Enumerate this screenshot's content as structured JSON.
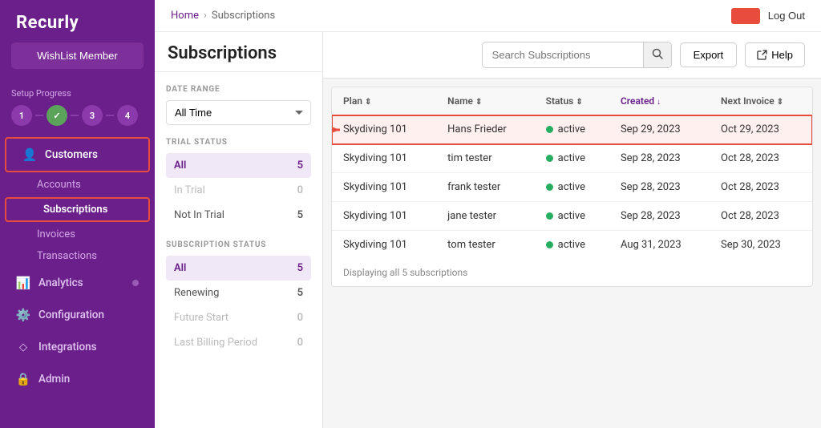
{
  "sidebar": {
    "logo": "Recurly",
    "member_button": "WishList Member",
    "setup": {
      "label": "Setup Progress",
      "steps": [
        "1",
        "✓",
        "3",
        "4"
      ]
    },
    "nav": [
      {
        "id": "customers",
        "label": "Customers",
        "icon": "👤",
        "active": true
      },
      {
        "id": "accounts",
        "label": "Accounts",
        "sub": true
      },
      {
        "id": "subscriptions",
        "label": "Subscriptions",
        "sub": true,
        "active": true
      },
      {
        "id": "invoices",
        "label": "Invoices",
        "sub": true
      },
      {
        "id": "transactions",
        "label": "Transactions",
        "sub": true
      },
      {
        "id": "analytics",
        "label": "Analytics",
        "icon": "📊",
        "dot": true
      },
      {
        "id": "configuration",
        "label": "Configuration",
        "icon": "⚙️"
      },
      {
        "id": "integrations",
        "label": "Integrations",
        "icon": "◇"
      },
      {
        "id": "admin",
        "label": "Admin",
        "icon": "🔒"
      }
    ]
  },
  "topbar": {
    "breadcrumb": {
      "home": "Home",
      "current": "Subscriptions"
    },
    "logout": "Log Out"
  },
  "page": {
    "title": "Subscriptions"
  },
  "search": {
    "placeholder": "Search Subscriptions"
  },
  "buttons": {
    "export": "Export",
    "help": "Help"
  },
  "filters": {
    "date_range": {
      "label": "DATE RANGE",
      "value": "All Time"
    },
    "trial_status": {
      "label": "TRIAL STATUS",
      "options": [
        {
          "label": "All",
          "count": "5",
          "active": true
        },
        {
          "label": "In Trial",
          "count": "0",
          "disabled": true
        },
        {
          "label": "Not In Trial",
          "count": "5",
          "disabled": false
        }
      ]
    },
    "subscription_status": {
      "label": "SUBSCRIPTION STATUS",
      "options": [
        {
          "label": "All",
          "count": "5",
          "active": true
        },
        {
          "label": "Renewing",
          "count": "5",
          "active": false
        },
        {
          "label": "Future Start",
          "count": "0",
          "disabled": true
        },
        {
          "label": "Last Billing Period",
          "count": "0",
          "disabled": true
        }
      ]
    }
  },
  "table": {
    "columns": [
      {
        "label": "Plan",
        "sort": true
      },
      {
        "label": "Name",
        "sort": true
      },
      {
        "label": "Status",
        "sort": true
      },
      {
        "label": "Created",
        "sort": true,
        "active": true
      },
      {
        "label": "Next Invoice",
        "sort": true
      }
    ],
    "rows": [
      {
        "plan": "Skydiving 101",
        "name": "Hans Frieder",
        "status": "active",
        "created": "Sep 29, 2023",
        "next_invoice": "Oct 29, 2023",
        "highlighted": true
      },
      {
        "plan": "Skydiving 101",
        "name": "tim tester",
        "status": "active",
        "created": "Sep 28, 2023",
        "next_invoice": "Oct 28, 2023",
        "highlighted": false
      },
      {
        "plan": "Skydiving 101",
        "name": "frank tester",
        "status": "active",
        "created": "Sep 28, 2023",
        "next_invoice": "Oct 28, 2023",
        "highlighted": false
      },
      {
        "plan": "Skydiving 101",
        "name": "jane tester",
        "status": "active",
        "created": "Sep 28, 2023",
        "next_invoice": "Oct 28, 2023",
        "highlighted": false
      },
      {
        "plan": "Skydiving 101",
        "name": "tom tester",
        "status": "active",
        "created": "Aug 31, 2023",
        "next_invoice": "Sep 30, 2023",
        "highlighted": false
      }
    ],
    "footer": "Displaying all 5 subscriptions"
  },
  "colors": {
    "sidebar_bg": "#6b1f8a",
    "active_dot": "#27ae60",
    "highlight_border": "#e74c3c",
    "purple": "#6b1f8a"
  }
}
